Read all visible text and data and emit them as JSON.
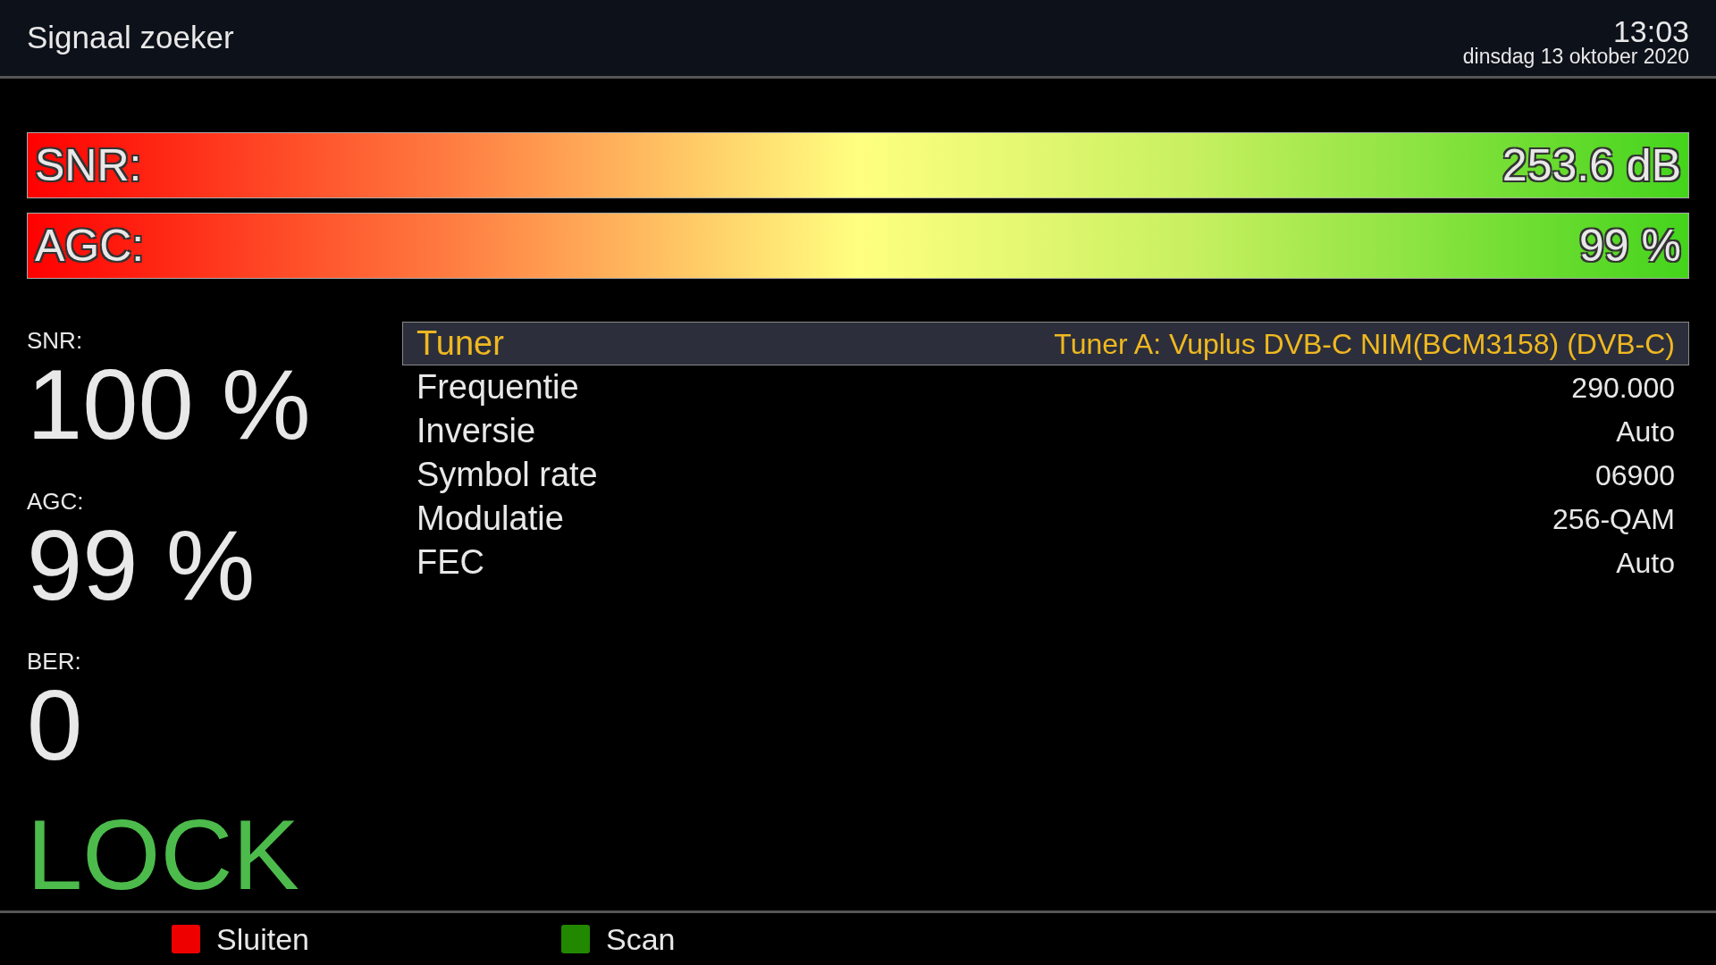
{
  "header": {
    "title": "Signaal zoeker",
    "time": "13:03",
    "date": "dinsdag 13 oktober 2020"
  },
  "bars": [
    {
      "label": "SNR:",
      "reading": "253.6 dB",
      "level": 1
    },
    {
      "label": "AGC:",
      "reading": "99 %",
      "level": 1
    }
  ],
  "stats": [
    {
      "label": "SNR:",
      "value": "100 %"
    },
    {
      "label": "AGC:",
      "value": "99 %"
    },
    {
      "label": "BER:",
      "value": "0"
    }
  ],
  "lock_status": "LOCK",
  "details": [
    {
      "label": "Tuner",
      "value": "Tuner A: Vuplus DVB-C NIM(BCM3158) (DVB-C)",
      "selected": true
    },
    {
      "label": "Frequentie",
      "value": "290.000",
      "selected": false
    },
    {
      "label": "Inversie",
      "value": "Auto",
      "selected": false
    },
    {
      "label": "Symbol rate",
      "value": "06900",
      "selected": false
    },
    {
      "label": "Modulatie",
      "value": "256-QAM",
      "selected": false
    },
    {
      "label": "FEC",
      "value": "Auto",
      "selected": false
    }
  ],
  "buttons": [
    {
      "label": "Sluiten",
      "color": "#ee0000"
    },
    {
      "label": "Scan",
      "color": "#228800"
    }
  ]
}
